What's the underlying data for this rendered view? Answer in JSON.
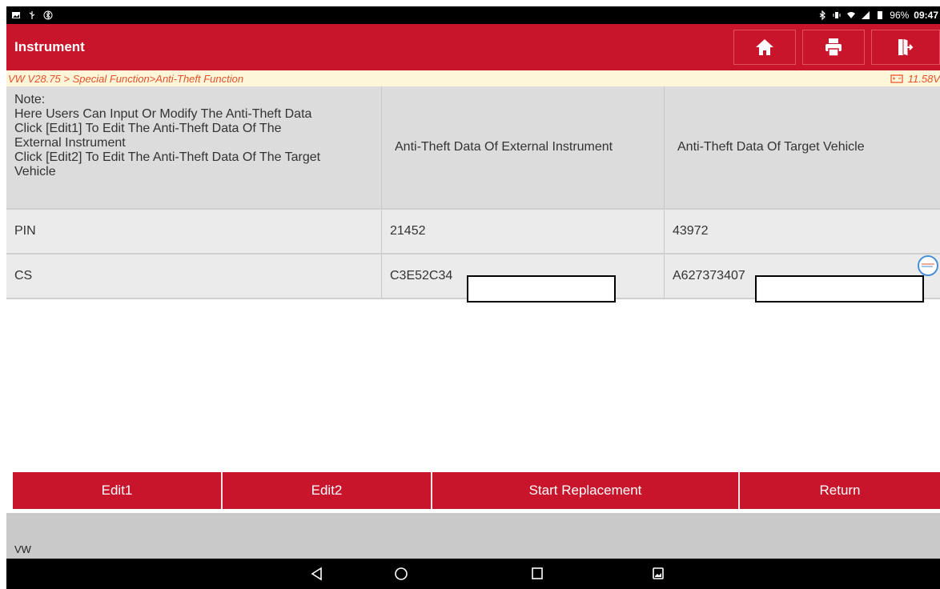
{
  "status": {
    "battery": "96%",
    "time": "09:47"
  },
  "header": {
    "title": "Instrument",
    "buttons": [
      "home-icon",
      "print-icon",
      "exit-icon"
    ]
  },
  "breadcrumb": {
    "path": "VW V28.75 > Special Function>Anti-Theft Function",
    "voltage": "11.58V"
  },
  "table": {
    "headers": {
      "note": "Note:\nHere Users Can Input Or Modify The Anti-Theft Data\nClick [Edit1] To Edit The Anti-Theft Data Of The\nExternal Instrument\nClick [Edit2] To Edit The Anti-Theft Data Of The Target\nVehicle",
      "external": "Anti-Theft Data Of External Instrument",
      "target": "Anti-Theft Data Of Target Vehicle"
    },
    "rows": [
      {
        "label": "PIN",
        "external": "21452",
        "target": "43972"
      },
      {
        "label": "CS",
        "external": "C3E52C34",
        "target": "A627373407"
      }
    ]
  },
  "buttons": {
    "edit1": "Edit1",
    "edit2": "Edit2",
    "start": "Start Replacement",
    "return": "Return"
  },
  "footer": {
    "text": "VW"
  },
  "colors": {
    "brand_red": "#c8152b",
    "breadcrumb_text": "#e8502c"
  }
}
